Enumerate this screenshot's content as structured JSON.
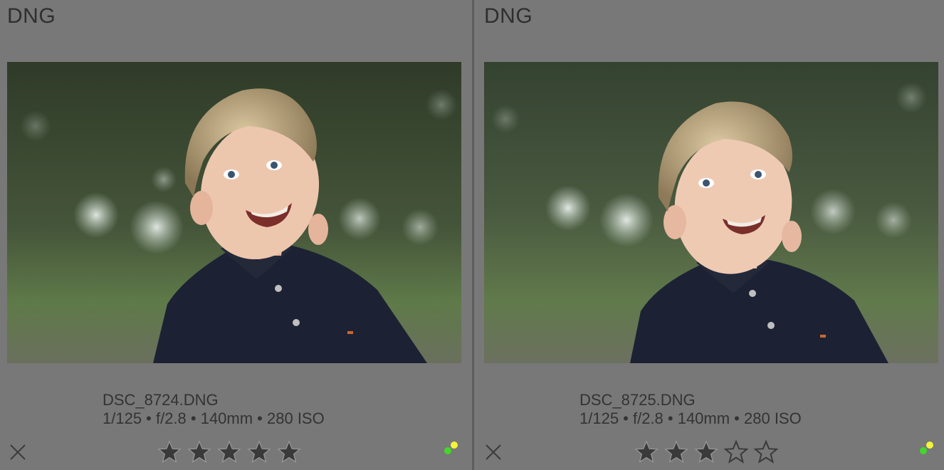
{
  "cells": [
    {
      "format": "DNG",
      "filename": "DSC_8724.DNG",
      "exif": "1/125 • f/2.8 • 140mm • 280 ISO",
      "rating": 5,
      "max_rating": 5
    },
    {
      "format": "DNG",
      "filename": "DSC_8725.DNG",
      "exif": "1/125 • f/2.8 • 140mm • 280 ISO",
      "rating": 3,
      "max_rating": 5
    }
  ],
  "colors": {
    "cell_bg": "#787878",
    "text": "#333333",
    "star_filled": "#3a3a3a",
    "status_green": "#44d62c",
    "status_yellow": "#f4f43a"
  },
  "icons": {
    "reject": "close-icon",
    "star": "star-icon",
    "status": "status-dots-icon"
  }
}
